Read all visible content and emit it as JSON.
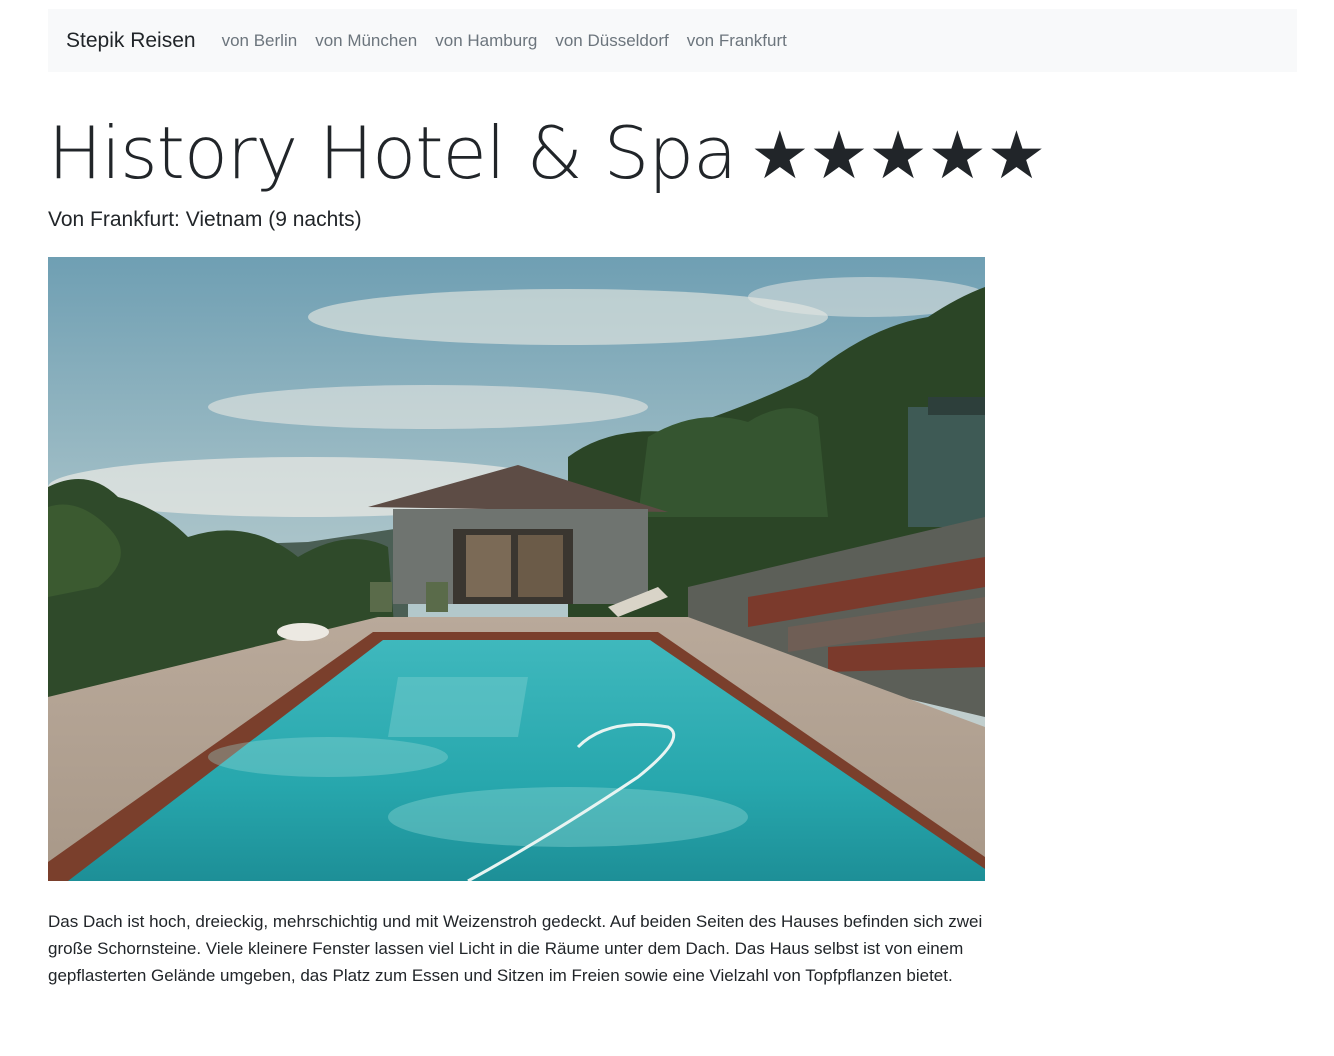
{
  "navbar": {
    "brand": "Stepik Reisen",
    "links": [
      {
        "label": "von Berlin"
      },
      {
        "label": "von München"
      },
      {
        "label": "von Hamburg"
      },
      {
        "label": "von Düsseldorf"
      },
      {
        "label": "von Frankfurt"
      }
    ]
  },
  "hotel": {
    "name": "History Hotel & Spa",
    "stars": "★★★★★",
    "star_rating": 5,
    "subtitle": "Von Frankfurt: Vietnam (9 nachts)",
    "description": "Das Dach ist hoch, dreieckig, mehrschichtig und mit Weizenstroh gedeckt. Auf beiden Seiten des Hauses befinden sich zwei große Schornsteine. Viele kleinere Fenster lassen viel Licht in die Räume unter dem Dach. Das Haus selbst ist von einem gepflasterten Gelände umgeben, das Platz zum Essen und Sitzen im Freien sowie eine Vielzahl von Topfpflanzen bietet."
  },
  "colors": {
    "navbar_bg": "#f8f9fa",
    "text": "#212529",
    "muted": "#6c757d"
  }
}
